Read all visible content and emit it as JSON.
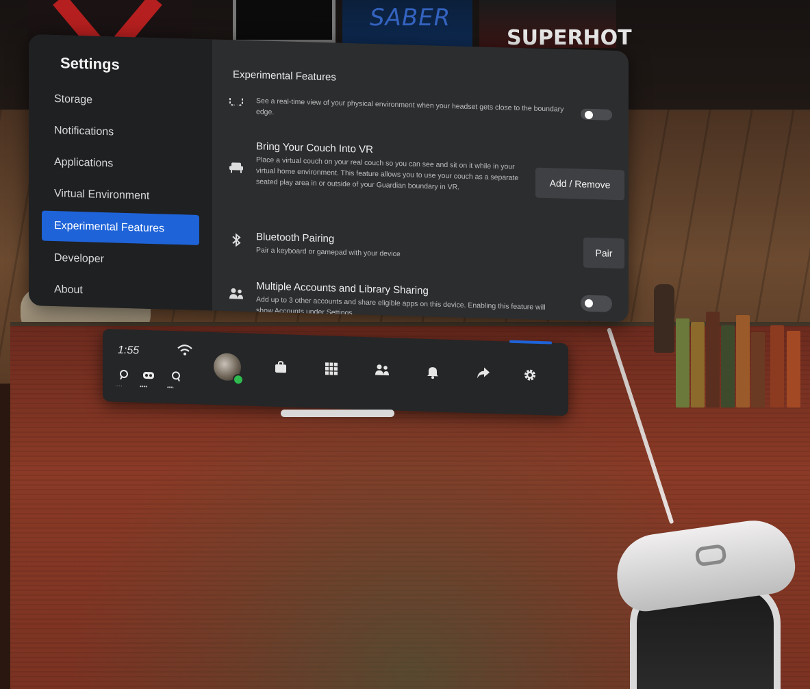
{
  "settings": {
    "title": "Settings",
    "sidebar": [
      {
        "label": "Storage"
      },
      {
        "label": "Notifications"
      },
      {
        "label": "Applications"
      },
      {
        "label": "Virtual Environment"
      },
      {
        "label": "Experimental Features",
        "active": true
      },
      {
        "label": "Developer"
      },
      {
        "label": "About"
      }
    ],
    "content_title": "Experimental Features",
    "features": {
      "passthrough": {
        "description": "See a real-time view of your physical environment when your headset gets close to the boundary edge.",
        "toggle_on": false
      },
      "couch": {
        "title": "Bring Your Couch Into VR",
        "description": "Place a virtual couch on your real couch so you can see and sit on it while in your virtual home environment. This feature allows you to use your couch as a separate seated play area in or outside of your Guardian boundary in VR.",
        "button": "Add / Remove"
      },
      "bluetooth": {
        "title": "Bluetooth Pairing",
        "description": "Pair a keyboard or gamepad with your device",
        "button": "Pair"
      },
      "accounts": {
        "title": "Multiple Accounts and Library Sharing",
        "description": "Add up to 3 other accounts and share eligible apps on this device. Enabling this feature will show Accounts under Settings.",
        "toggle_on": false
      }
    }
  },
  "menu_bar": {
    "time": "1:55",
    "devices": [
      {
        "icon": "left-controller-icon",
        "dots": "····"
      },
      {
        "icon": "headset-icon",
        "dots": "••••"
      },
      {
        "icon": "right-controller-icon",
        "dots": "•••·"
      }
    ],
    "nav": [
      "store-icon",
      "apps-icon",
      "people-icon",
      "notifications-icon",
      "share-icon",
      "settings-icon"
    ],
    "active": "settings-icon"
  },
  "environment": {
    "poster_left": "SABER",
    "poster_right": "SUPERHOT"
  },
  "colors": {
    "accent": "#1e63d8",
    "panel": "#2c2d2f",
    "sidebar": "#1f2022",
    "online": "#2fbb4f"
  }
}
